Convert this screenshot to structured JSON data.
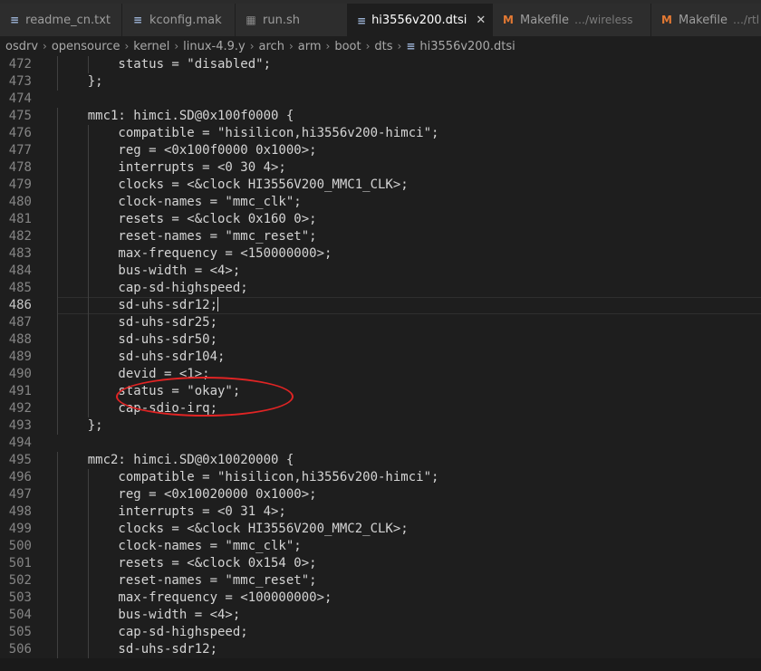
{
  "tabs": [
    {
      "label": "readme_cn.txt",
      "icon": "lines-icon",
      "active": false
    },
    {
      "label": "kconfig.mak",
      "icon": "lines-icon",
      "active": false
    },
    {
      "label": "run.sh",
      "icon": "terminal-file-icon",
      "active": false
    },
    {
      "label": "hi3556v200.dtsi",
      "icon": "lines-icon",
      "active": true,
      "close": "✕"
    },
    {
      "label": "Makefile",
      "icon": "makefile-icon",
      "active": false,
      "desc": "…/wireless"
    },
    {
      "label": "Makefile",
      "icon": "makefile-icon",
      "active": false,
      "desc": "…/rtl"
    }
  ],
  "breadcrumb": [
    "osdrv",
    "opensource",
    "kernel",
    "linux-4.9.y",
    "arch",
    "arm",
    "boot",
    "dts",
    "hi3556v200.dtsi"
  ],
  "editor": {
    "current_line": 486,
    "lines": [
      {
        "n": "472",
        "text": "        status = \"disabled\";"
      },
      {
        "n": "473",
        "text": "    };"
      },
      {
        "n": "474",
        "text": ""
      },
      {
        "n": "475",
        "text": "    mmc1: himci.SD@0x100f0000 {"
      },
      {
        "n": "476",
        "text": "        compatible = \"hisilicon,hi3556v200-himci\";"
      },
      {
        "n": "477",
        "text": "        reg = <0x100f0000 0x1000>;"
      },
      {
        "n": "478",
        "text": "        interrupts = <0 30 4>;"
      },
      {
        "n": "479",
        "text": "        clocks = <&clock HI3556V200_MMC1_CLK>;"
      },
      {
        "n": "480",
        "text": "        clock-names = \"mmc_clk\";"
      },
      {
        "n": "481",
        "text": "        resets = <&clock 0x160 0>;"
      },
      {
        "n": "482",
        "text": "        reset-names = \"mmc_reset\";"
      },
      {
        "n": "483",
        "text": "        max-frequency = <150000000>;"
      },
      {
        "n": "484",
        "text": "        bus-width = <4>;"
      },
      {
        "n": "485",
        "text": "        cap-sd-highspeed;"
      },
      {
        "n": "486",
        "text": "        sd-uhs-sdr12;"
      },
      {
        "n": "487",
        "text": "        sd-uhs-sdr25;"
      },
      {
        "n": "488",
        "text": "        sd-uhs-sdr50;"
      },
      {
        "n": "489",
        "text": "        sd-uhs-sdr104;"
      },
      {
        "n": "490",
        "text": "        devid = <1>;"
      },
      {
        "n": "491",
        "text": "        status = \"okay\";"
      },
      {
        "n": "492",
        "text": "        cap-sdio-irq;"
      },
      {
        "n": "493",
        "text": "    };"
      },
      {
        "n": "494",
        "text": ""
      },
      {
        "n": "495",
        "text": "    mmc2: himci.SD@0x10020000 {"
      },
      {
        "n": "496",
        "text": "        compatible = \"hisilicon,hi3556v200-himci\";"
      },
      {
        "n": "497",
        "text": "        reg = <0x10020000 0x1000>;"
      },
      {
        "n": "498",
        "text": "        interrupts = <0 31 4>;"
      },
      {
        "n": "499",
        "text": "        clocks = <&clock HI3556V200_MMC2_CLK>;"
      },
      {
        "n": "500",
        "text": "        clock-names = \"mmc_clk\";"
      },
      {
        "n": "501",
        "text": "        resets = <&clock 0x154 0>;"
      },
      {
        "n": "502",
        "text": "        reset-names = \"mmc_reset\";"
      },
      {
        "n": "503",
        "text": "        max-frequency = <100000000>;"
      },
      {
        "n": "504",
        "text": "        bus-width = <4>;"
      },
      {
        "n": "505",
        "text": "        cap-sd-highspeed;"
      },
      {
        "n": "506",
        "text": "        sd-uhs-sdr12;"
      }
    ]
  },
  "annotation": {
    "shape": "ellipse",
    "color": "#e02424",
    "highlights_lines": [
      "491",
      "492"
    ]
  },
  "colors": {
    "editor_bg": "#1e1e1e",
    "tabbar_bg": "#252526",
    "text": "#d4d4d4",
    "line_number": "#858585",
    "makefile_icon": "#e37933"
  }
}
